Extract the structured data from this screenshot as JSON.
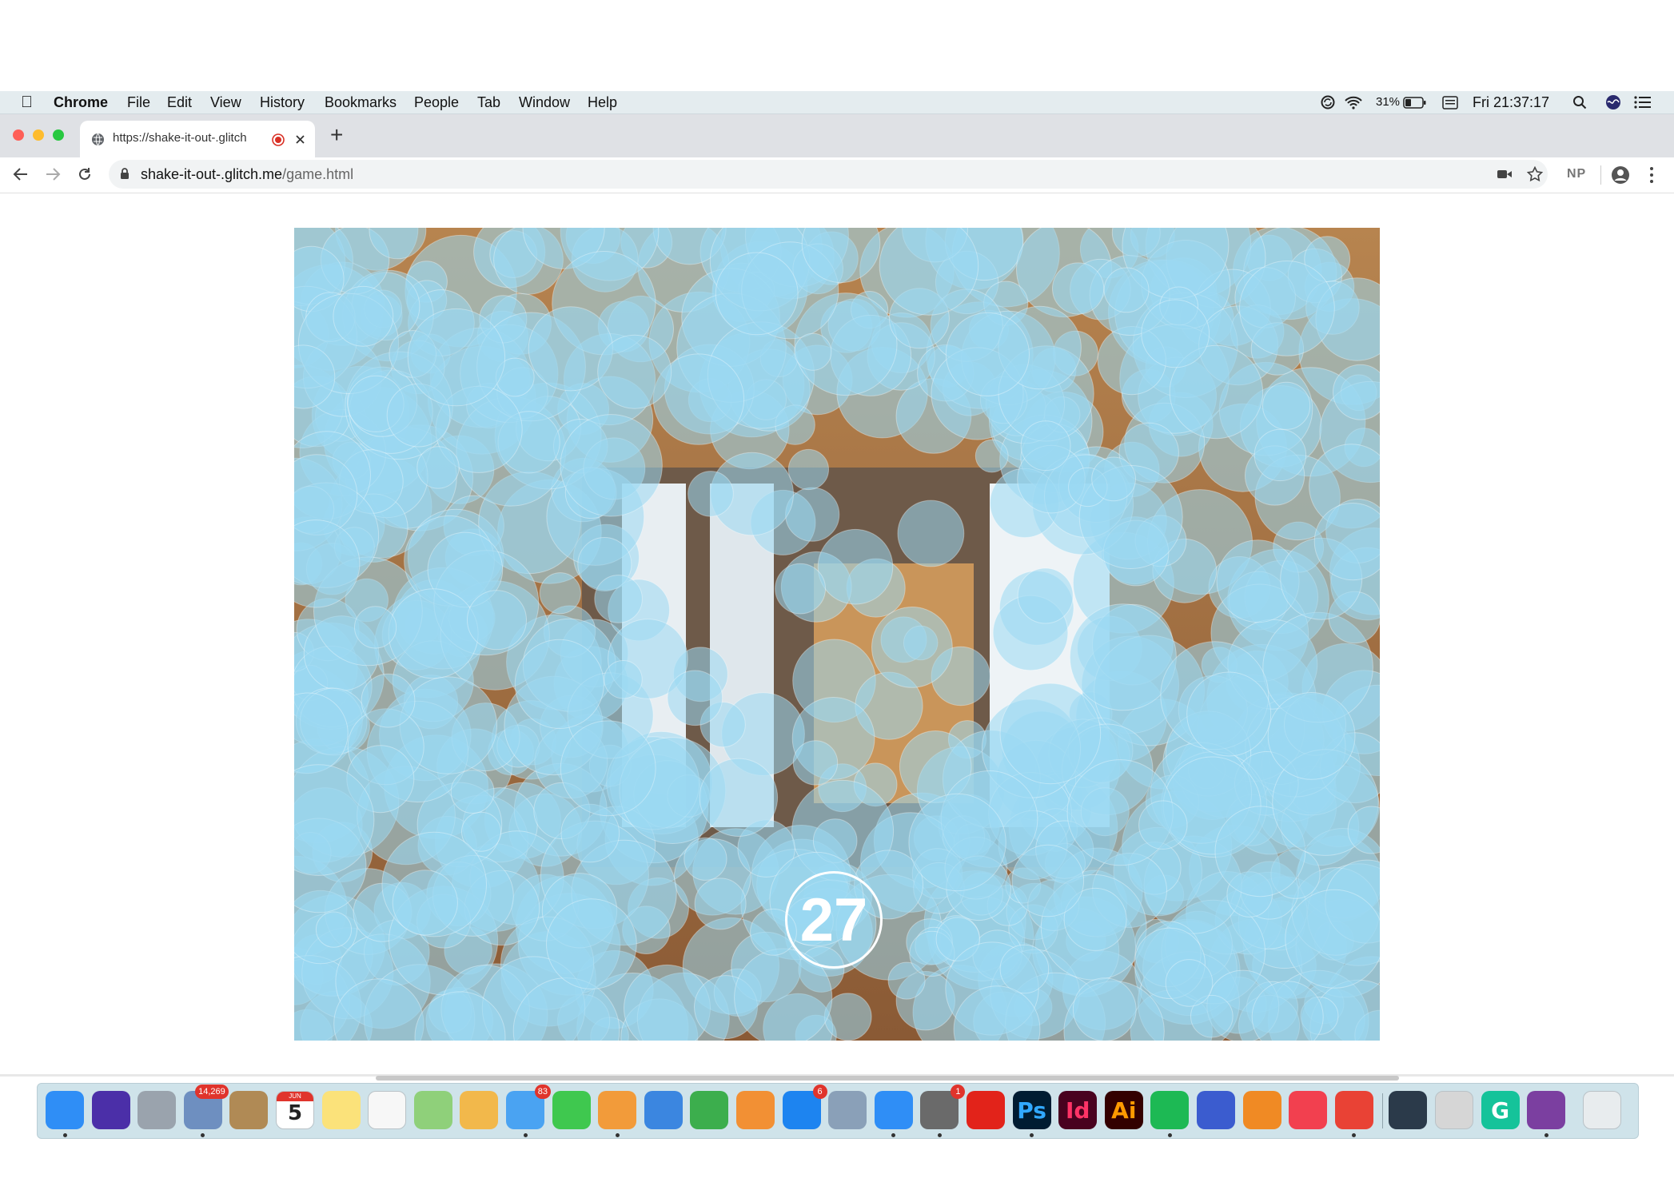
{
  "menubar": {
    "app_name": "Chrome",
    "items": [
      "File",
      "Edit",
      "View",
      "History",
      "Bookmarks",
      "People",
      "Tab",
      "Window",
      "Help"
    ],
    "battery": "31%",
    "clock": "Fri 21:37:17"
  },
  "browser": {
    "tab_title": "https://shake-it-out-.glitch",
    "new_tab": "+",
    "url_domain": "shake-it-out-.glitch.me",
    "url_path": "/game.html",
    "extension_label": "NP"
  },
  "game": {
    "countdown": "27"
  },
  "dock": {
    "apps": [
      {
        "name": "finder-icon",
        "color": "#2f8ef6"
      },
      {
        "name": "siri-icon",
        "color": "#4b2fa8"
      },
      {
        "name": "launchpad-icon",
        "color": "#9aa3ad"
      },
      {
        "name": "mail-icon",
        "color": "#6e8fc0",
        "badge": "14,269"
      },
      {
        "name": "contacts-icon",
        "color": "#b08a55"
      },
      {
        "name": "calendar-icon",
        "color": "#ffffff",
        "label": "5",
        "sublabel": "JUN"
      },
      {
        "name": "notes-icon",
        "color": "#fbe27a"
      },
      {
        "name": "reminders-icon",
        "color": "#f7f7f7"
      },
      {
        "name": "maps-icon",
        "color": "#8fd07a"
      },
      {
        "name": "photos-icon",
        "color": "#f2b84b"
      },
      {
        "name": "messages-icon",
        "color": "#4aa3f2",
        "badge": "83"
      },
      {
        "name": "facetime-icon",
        "color": "#3fc84f"
      },
      {
        "name": "pages-icon",
        "color": "#f29b3a"
      },
      {
        "name": "keynote-icon",
        "color": "#3b86e0"
      },
      {
        "name": "numbers-icon",
        "color": "#3cae4d"
      },
      {
        "name": "books-icon",
        "color": "#f29034"
      },
      {
        "name": "app-store-icon",
        "color": "#1d84f0",
        "badge": "6"
      },
      {
        "name": "preview-icon",
        "color": "#8aa0b8"
      },
      {
        "name": "safari-icon",
        "color": "#2f8ef6"
      },
      {
        "name": "system-preferences-icon",
        "color": "#6a6a6a",
        "badge": "1"
      },
      {
        "name": "creative-cloud-icon",
        "color": "#e2231a"
      },
      {
        "name": "photoshop-icon",
        "color": "#001c32",
        "label": "Ps",
        "label_color": "#31a8ff"
      },
      {
        "name": "indesign-icon",
        "color": "#49021f",
        "label": "Id",
        "label_color": "#ff3366"
      },
      {
        "name": "illustrator-icon",
        "color": "#330000",
        "label": "Ai",
        "label_color": "#ff9a00"
      },
      {
        "name": "spotify-icon",
        "color": "#1db954"
      },
      {
        "name": "sketch-like-icon",
        "color": "#3b5ccf"
      },
      {
        "name": "blender-icon",
        "color": "#f08a24"
      },
      {
        "name": "news-icon",
        "color": "#f2404f"
      },
      {
        "name": "chrome-icon",
        "color": "#e94235"
      },
      {
        "name": "quicktime-icon",
        "color": "#2b3a4a"
      },
      {
        "name": "xcode-like-icon",
        "color": "#d6d6d6"
      },
      {
        "name": "grammarly-icon",
        "color": "#15c39a",
        "label": "G"
      },
      {
        "name": "github-icon",
        "color": "#7b3fa0"
      },
      {
        "name": "trash-icon",
        "color": "#e8ecee"
      }
    ]
  }
}
